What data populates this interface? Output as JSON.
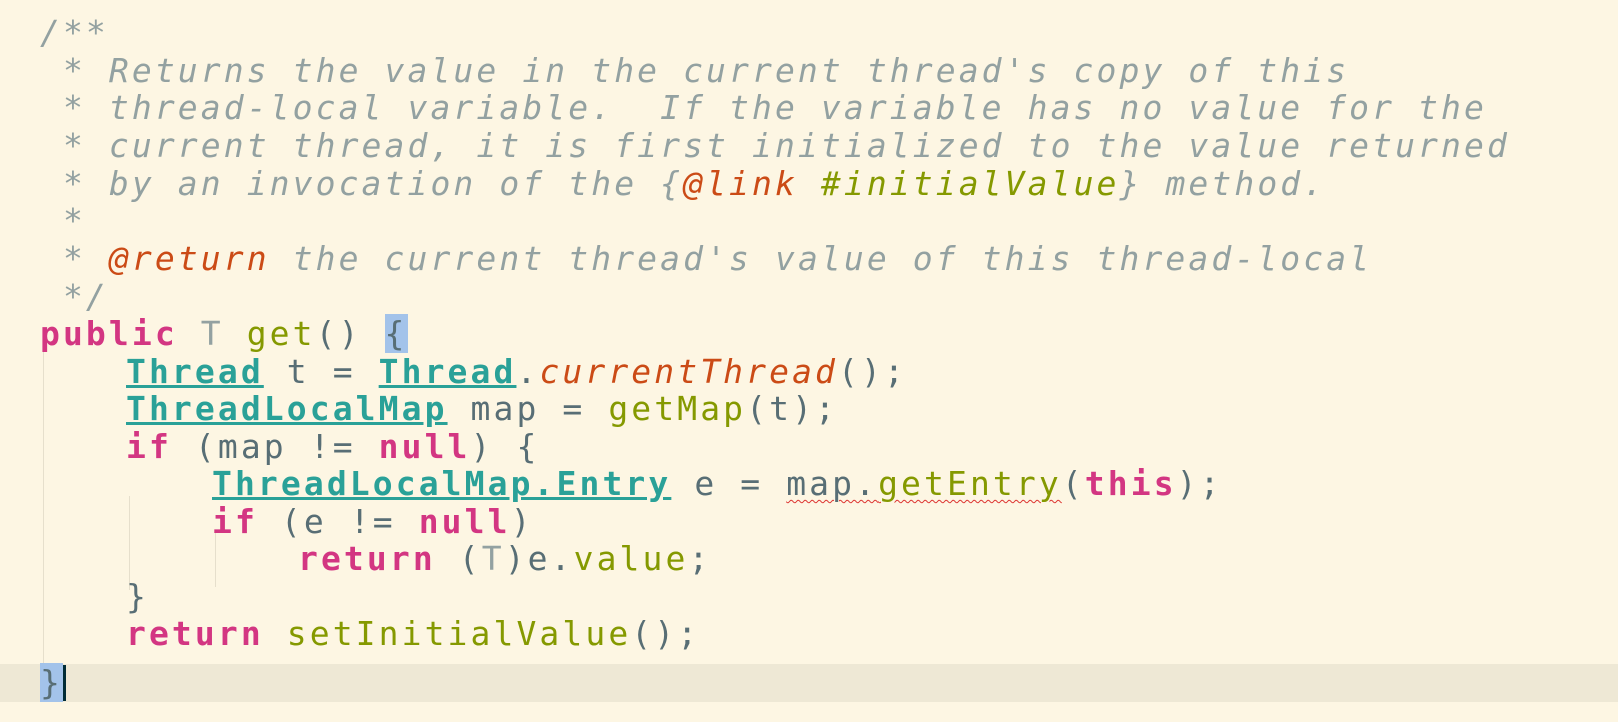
{
  "editor": {
    "doc_comment": {
      "open": "/**",
      "line1": " * Returns the value in the current thread's copy of this",
      "line2": " * thread-local variable.  If the variable has no value for the",
      "line3": " * current thread, it is first initialized to the value returned",
      "line4_prefix": " * by an invocation of the {",
      "line4_tag": "@link",
      "line4_space": " ",
      "line4_ref": "#initialValue",
      "line4_suffix": "} method.",
      "line5": " *",
      "line6_prefix": " * ",
      "line6_tag": "@return",
      "line6_suffix": " the current thread's value of this thread-local",
      "close": " */"
    },
    "signature": {
      "modifier": "public",
      "return_type": "T",
      "method_name": "get",
      "params": "()",
      "open_brace": "{"
    },
    "body": {
      "l1_type": "Thread",
      "l1_var": " t = ",
      "l1_type2": "Thread",
      "l1_dot": ".",
      "l1_call": "currentThread",
      "l1_end": "();",
      "l2_type": "ThreadLocalMap",
      "l2_var": " map = ",
      "l2_call": "getMap",
      "l2_end": "(t);",
      "l3_if": "if",
      "l3_cond": " (map != ",
      "l3_null": "null",
      "l3_end": ") {",
      "l4_type": "ThreadLocalMap.Entry",
      "l4_var": " e = ",
      "l4_obj": "map.",
      "l4_call": "getEntry",
      "l4_paren": "(",
      "l4_this": "this",
      "l4_end": ");",
      "l5_if": "if",
      "l5_cond": " (e != ",
      "l5_null": "null",
      "l5_end": ")",
      "l6_return": "return",
      "l6_cast_open": " (",
      "l6_cast_type": "T",
      "l6_cast_close": ")e.",
      "l6_field": "value",
      "l6_end": ";",
      "l7_close": "}",
      "l8_return": "return",
      "l8_space": " ",
      "l8_call": "setInitialValue",
      "l8_end": "();",
      "close_brace": "}"
    }
  }
}
